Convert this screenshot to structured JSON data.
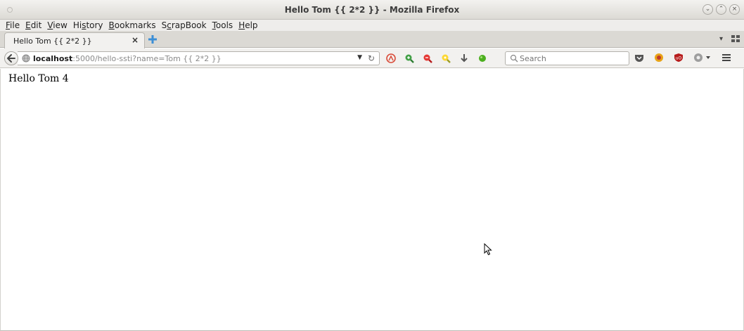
{
  "window": {
    "title": "Hello Tom {{ 2*2 }} - Mozilla Firefox"
  },
  "menubar": {
    "items": [
      {
        "label": "File"
      },
      {
        "label": "Edit"
      },
      {
        "label": "View"
      },
      {
        "label": "History"
      },
      {
        "label": "Bookmarks"
      },
      {
        "label": "ScrapBook"
      },
      {
        "label": "Tools"
      },
      {
        "label": "Help"
      }
    ]
  },
  "tabs": [
    {
      "label": "Hello Tom {{ 2*2 }}",
      "active": true
    }
  ],
  "navbar": {
    "url_host": "localhost",
    "url_rest": ":5000/hello-ssti?name=Tom {{ 2*2 }}",
    "search_placeholder": "Search"
  },
  "page": {
    "text": "Hello Tom 4"
  },
  "icons": {
    "back": "back-arrow-icon",
    "globe": "globe-icon",
    "reload": "reload-icon",
    "pocket": "pocket-icon",
    "hackbar": "hackbar-icon",
    "ublock": "ublock-icon",
    "menu": "hamburger-menu-icon"
  },
  "colors": {
    "chrome_bg": "#f2f1ef",
    "titlebar_bg": "#dcdad5",
    "url_host": "#1a1a1a",
    "url_rest": "#8a8a8a"
  }
}
